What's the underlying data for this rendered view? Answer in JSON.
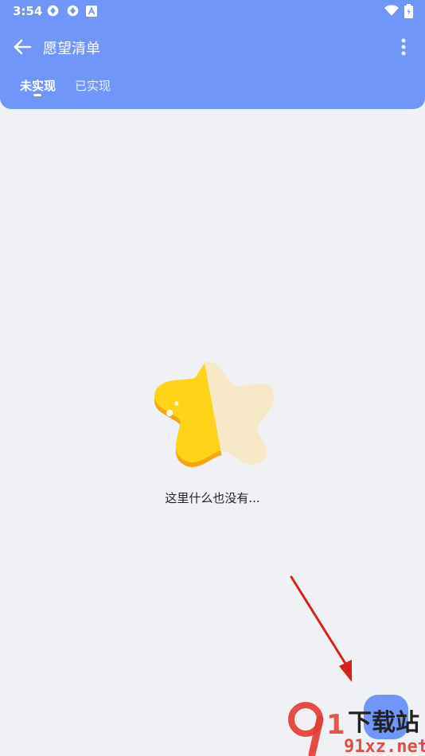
{
  "status_bar": {
    "time": "3:54",
    "icons": [
      "sync-icon",
      "sync-icon",
      "a-badge-icon",
      "wifi-icon",
      "battery-icon"
    ]
  },
  "toolbar": {
    "title": "愿望清单",
    "back_icon": "arrow-left-icon",
    "more_icon": "more-vertical-icon"
  },
  "tabs": [
    {
      "label": "未实现",
      "active": true
    },
    {
      "label": "已实现",
      "active": false
    }
  ],
  "empty_state": {
    "text": "这里什么也没有..."
  },
  "colors": {
    "header": "#7196f9",
    "background": "#f0f1f5",
    "star_yellow": "#ffd317",
    "star_cream": "#f7e9c8",
    "arrow_red": "#d8201d"
  },
  "watermark": {
    "logo": "9",
    "text": "下载站",
    "domain": "91xz.net"
  }
}
